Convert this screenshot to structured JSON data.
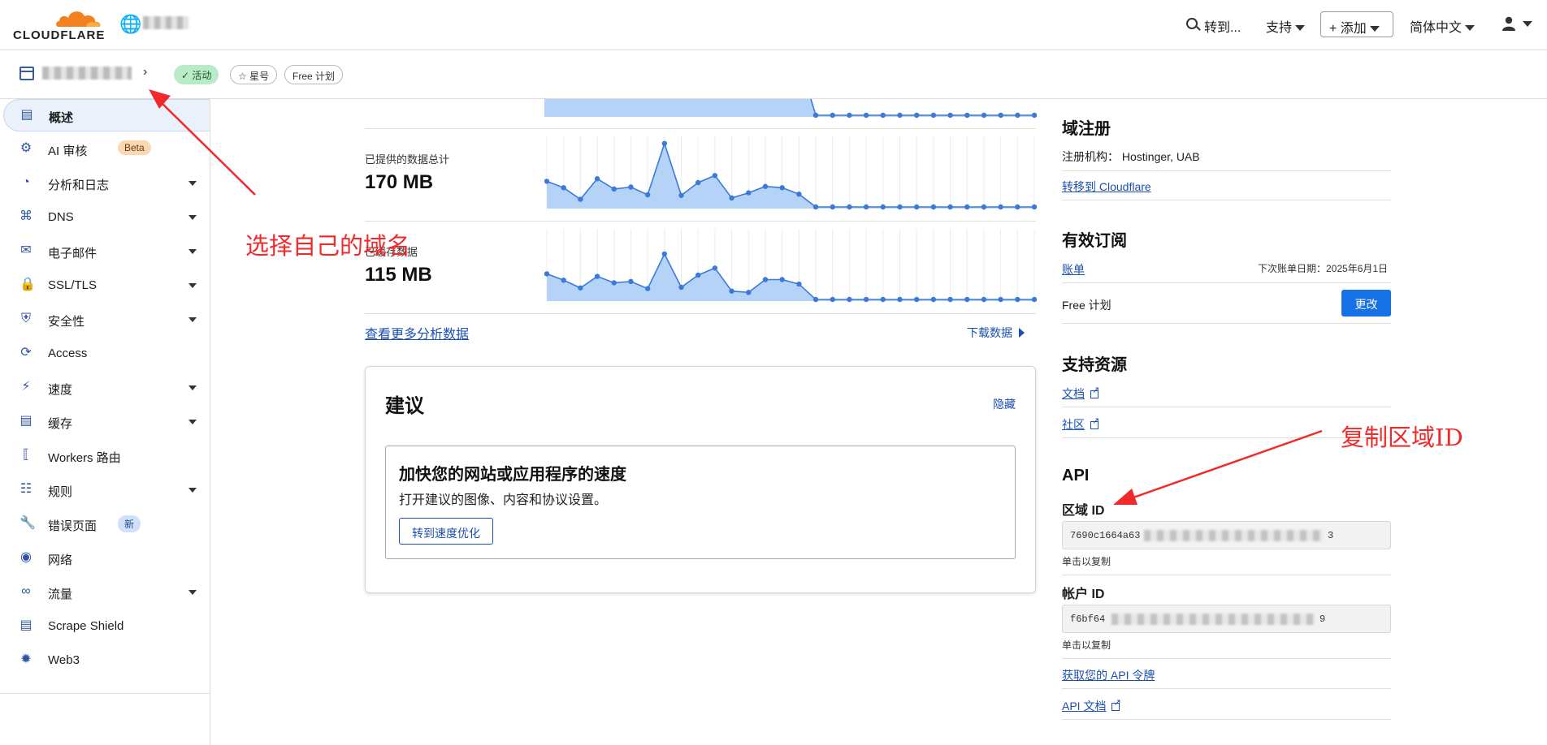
{
  "header": {
    "logo_text": "CLOUDFLARE",
    "search_label": "转到...",
    "support_label": "支持",
    "add_label": "+ 添加",
    "language_label": "简体中文"
  },
  "zone": {
    "status_label": "活动",
    "star_label": "星号",
    "plan_label": "Free 计划"
  },
  "sidebar": {
    "items": [
      {
        "label": "概述",
        "icon": "clipboard-icon",
        "has_submenu": false,
        "active": true
      },
      {
        "label": "AI 审核",
        "icon": "robot-icon",
        "has_submenu": false,
        "badge": "Beta"
      },
      {
        "label": "分析和日志",
        "icon": "chart-pie-icon",
        "has_submenu": true
      },
      {
        "label": "DNS",
        "icon": "network-icon",
        "has_submenu": true
      },
      {
        "label": "电子邮件",
        "icon": "mail-icon",
        "has_submenu": true
      },
      {
        "label": "SSL/TLS",
        "icon": "lock-icon",
        "has_submenu": true
      },
      {
        "label": "安全性",
        "icon": "shield-icon",
        "has_submenu": true
      },
      {
        "label": "Access",
        "icon": "access-icon",
        "has_submenu": false
      },
      {
        "label": "速度",
        "icon": "bolt-icon",
        "has_submenu": true
      },
      {
        "label": "缓存",
        "icon": "cache-icon",
        "has_submenu": true
      },
      {
        "label": "Workers 路由",
        "icon": "workers-icon",
        "has_submenu": false
      },
      {
        "label": "规则",
        "icon": "rules-icon",
        "has_submenu": true
      },
      {
        "label": "错误页面",
        "icon": "wrench-icon",
        "has_submenu": false,
        "badge": "新"
      },
      {
        "label": "网络",
        "icon": "location-icon",
        "has_submenu": false
      },
      {
        "label": "流量",
        "icon": "traffic-icon",
        "has_submenu": true
      },
      {
        "label": "Scrape Shield",
        "icon": "document-icon",
        "has_submenu": false
      },
      {
        "label": "Web3",
        "icon": "web3-icon",
        "has_submenu": false
      }
    ]
  },
  "charts": [
    {
      "label": "已提供的数据总计",
      "value": "170 MB"
    },
    {
      "label": "已缓存数据",
      "value": "115 MB"
    }
  ],
  "chart_data": [
    {
      "type": "area",
      "series": [
        {
          "values": [
            40,
            30,
            12,
            44,
            28,
            31,
            19,
            99,
            18,
            38,
            49,
            14,
            22,
            32,
            30,
            20,
            0,
            0,
            0,
            0,
            0,
            0,
            0,
            0,
            0,
            0,
            0,
            0,
            0,
            0
          ]
        }
      ]
    },
    {
      "type": "area",
      "series": [
        {
          "values": [
            40,
            30,
            18,
            36,
            26,
            28,
            17,
            71,
            19,
            38,
            49,
            13,
            11,
            31,
            31,
            24,
            0,
            0,
            0,
            0,
            0,
            0,
            0,
            0,
            0,
            0,
            0,
            0,
            0,
            0
          ]
        }
      ]
    }
  ],
  "analytics": {
    "more_link": "查看更多分析数据",
    "download_link": "下载数据"
  },
  "recommendations": {
    "title": "建议",
    "hide_label": "隐藏",
    "item_title": "加快您的网站或应用程序的速度",
    "item_desc": "打开建议的图像、内容和协议设置。",
    "item_button": "转到速度优化"
  },
  "right": {
    "registration_title": "域注册",
    "registrar_label": "注册机构：",
    "registrar_value": "Hostinger, UAB",
    "transfer_link": "转移到 Cloudflare",
    "subscription_title": "有效订阅",
    "billing_link": "账单",
    "next_billing": "下次账单日期：2025年6月1日",
    "plan_label": "Free 计划",
    "change_button": "更改",
    "support_title": "支持资源",
    "docs_link": "文档",
    "community_link": "社区",
    "api_title": "API",
    "zone_id_label": "区域 ID",
    "zone_id_prefix": "7690c1664a63",
    "zone_id_suffix": "3",
    "account_id_label": "帐户 ID",
    "account_id_prefix": "f6bf64",
    "account_id_suffix": "9",
    "copy_hint": "单击以复制",
    "api_token_link": "获取您的 API 令牌",
    "api_docs_link": "API 文档"
  },
  "annotations": {
    "select_domain": "选择自己的域名",
    "copy_zone_id": "复制区域ID",
    "color": "#f02a2a"
  }
}
